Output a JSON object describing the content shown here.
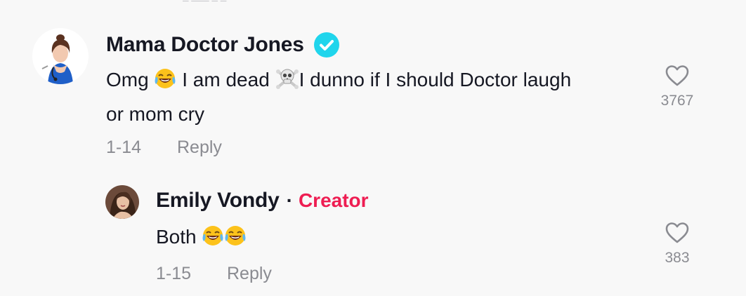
{
  "comments": [
    {
      "username": "Mama Doctor Jones",
      "verified": true,
      "text_parts": [
        "Omg",
        "I am dead",
        "I dunno if I should Doctor laugh",
        "or mom cry"
      ],
      "date": "1-14",
      "reply_label": "Reply",
      "like_count": "3767",
      "avatar": "avatar-doctor"
    }
  ],
  "reply": {
    "username": "Emily Vondy",
    "separator": "·",
    "badge": "Creator",
    "text": "Both",
    "date": "1-15",
    "reply_label": "Reply",
    "like_count": "383",
    "avatar": "avatar-emily"
  },
  "colors": {
    "background": "#f8f8f8",
    "text": "#161823",
    "muted": "#8a8b91",
    "creator": "#ee1d52",
    "verified": "#20d5ec"
  },
  "icons": {
    "verified": "verified-check-icon",
    "laugh": "face-with-tears-of-joy-emoji",
    "skull": "skull-and-crossbones-emoji",
    "like": "heart-outline-icon"
  }
}
